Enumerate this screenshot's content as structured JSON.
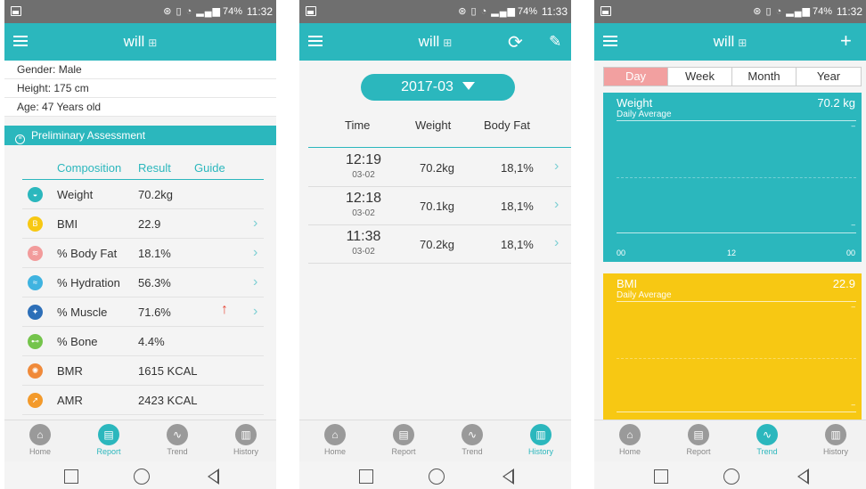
{
  "status": {
    "battery": "74%",
    "time1": "11:32",
    "time2": "11:33",
    "time3": "11:32"
  },
  "user": {
    "name": "will"
  },
  "profile": {
    "gender": "Gender: Male",
    "height": "Height: 175 cm",
    "age": "Age: 47 Years old"
  },
  "assessment": {
    "title": "Preliminary Assessment",
    "headers": {
      "composition": "Composition",
      "result": "Result",
      "guide": "Guide"
    },
    "rows": [
      {
        "name": "Weight",
        "result": "70.2kg",
        "icon": "scale-icon",
        "color": "#2bb7bd",
        "glyph": "◒"
      },
      {
        "name": "BMI",
        "result": "22.9",
        "icon": "bmi-icon",
        "color": "#f7c813",
        "glyph": "B"
      },
      {
        "name": "% Body Fat",
        "result": "18.1%",
        "icon": "body-fat-icon",
        "color": "#f29b9b",
        "glyph": "≋"
      },
      {
        "name": "% Hydration",
        "result": "56.3%",
        "icon": "hydration-icon",
        "color": "#3fb3e0",
        "glyph": "≈"
      },
      {
        "name": "% Muscle",
        "result": "71.6%",
        "icon": "muscle-icon",
        "color": "#2d6fb8",
        "glyph": "✦"
      },
      {
        "name": "% Bone",
        "result": "4.4%",
        "icon": "bone-icon",
        "color": "#74c44b",
        "glyph": "⊷"
      },
      {
        "name": "BMR",
        "result": "1615 KCAL",
        "icon": "bmr-icon",
        "color": "#f08a3a",
        "glyph": "✺"
      },
      {
        "name": "AMR",
        "result": "2423 KCAL",
        "icon": "amr-icon",
        "color": "#f39a2b",
        "glyph": "➚"
      }
    ],
    "muscle_guide": "↑"
  },
  "history": {
    "month": "2017-03",
    "headers": {
      "time": "Time",
      "weight": "Weight",
      "fat": "Body Fat"
    },
    "rows": [
      {
        "time": "12:19",
        "date": "03-02",
        "weight": "70.2kg",
        "fat": "18,1%"
      },
      {
        "time": "12:18",
        "date": "03-02",
        "weight": "70.1kg",
        "fat": "18,1%"
      },
      {
        "time": "11:38",
        "date": "03-02",
        "weight": "70.2kg",
        "fat": "18,1%"
      }
    ]
  },
  "trend": {
    "tabs": [
      "Day",
      "Week",
      "Month",
      "Year"
    ],
    "active_tab": "Day",
    "weight": {
      "title": "Weight",
      "value": "70.2 kg",
      "sub": "Daily Average",
      "x": [
        "00",
        "12",
        "00"
      ],
      "color": "#2bb7bd"
    },
    "bmi": {
      "title": "BMI",
      "value": "22.9",
      "sub": "Daily Average",
      "color": "#f7c813"
    }
  },
  "nav": [
    "Home",
    "Report",
    "Trend",
    "History"
  ]
}
